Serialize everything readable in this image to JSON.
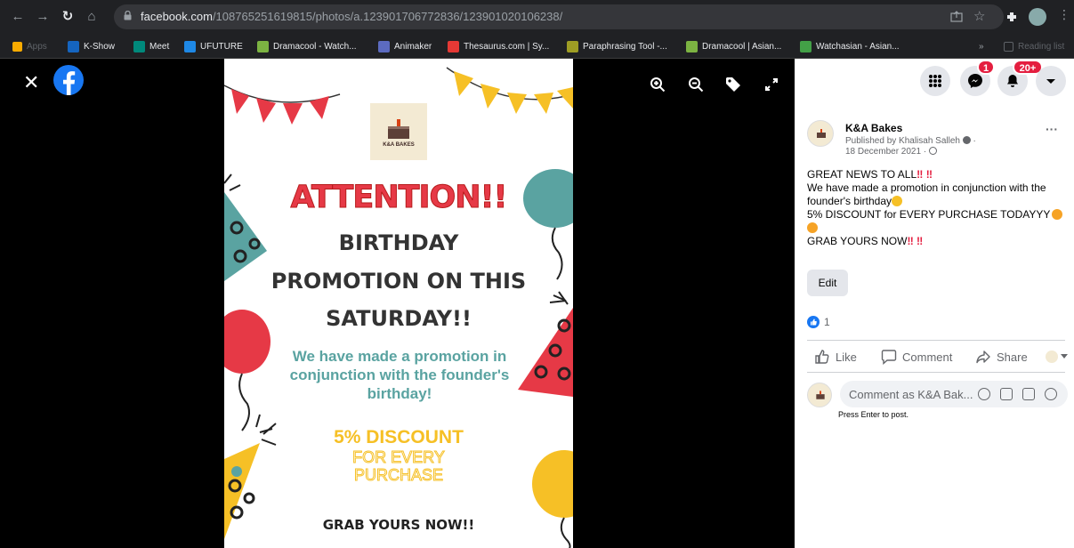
{
  "browser": {
    "url_host": "facebook.com",
    "url_path": "/108765251619815/photos/a.123901706772836/123901020106238/",
    "bookmarks": [
      {
        "label": "Apps",
        "color": "#4285f4"
      },
      {
        "label": "K-Show",
        "color": "#1565c0"
      },
      {
        "label": "Meet",
        "color": "#00897b"
      },
      {
        "label": "UFUTURE",
        "color": "#1e88e5"
      },
      {
        "label": "Dramacool - Watch...",
        "color": "#7cb342"
      },
      {
        "label": "Animaker",
        "color": "#5c6bc0"
      },
      {
        "label": "Thesaurus.com | Sy...",
        "color": "#e53935"
      },
      {
        "label": "Paraphrasing Tool -...",
        "color": "#9e9d24"
      },
      {
        "label": "Dramacool | Asian...",
        "color": "#7cb342"
      },
      {
        "label": "Watchasian - Asian...",
        "color": "#43a047"
      }
    ],
    "more": "»",
    "reading_list": "Reading list"
  },
  "poster": {
    "logo_text": "K&A BAKES",
    "heading": "ATTENTION!!",
    "line1": "BIRTHDAY",
    "line2": "PROMOTION ON THIS",
    "line3": "SATURDAY!!",
    "body": "We have made a promotion in conjunction with the founder's birthday!",
    "discount": "5% DISCOUNT",
    "discount_sub1": "FOR EVERY",
    "discount_sub2": "PURCHASE",
    "grab": "GRAB YOURS NOW!!"
  },
  "header_badges": {
    "messenger": "1",
    "notifications": "20+"
  },
  "post": {
    "page_name": "K&A Bakes",
    "published_by": "Published by Khalisah Salleh",
    "date": "18 December 2021 ·",
    "line1": "GREAT NEWS TO ALL",
    "line2": "We have made a promotion in conjunction with the founder's birthday",
    "line3": "5% DISCOUNT for EVERY PURCHASE TODAYYY",
    "line4": "GRAB YOURS NOW",
    "edit": "Edit",
    "reactions": "1",
    "more": "···"
  },
  "actions": {
    "like": "Like",
    "comment": "Comment",
    "share": "Share"
  },
  "comment": {
    "placeholder": "Comment as K&A Bak...",
    "hint": "Press Enter to post."
  },
  "colors": {
    "facebook": "#1877f2",
    "badge": "#e41e3f",
    "poster_red": "#e63946",
    "poster_teal": "#5aa3a1",
    "poster_yellow": "#f6c026"
  }
}
